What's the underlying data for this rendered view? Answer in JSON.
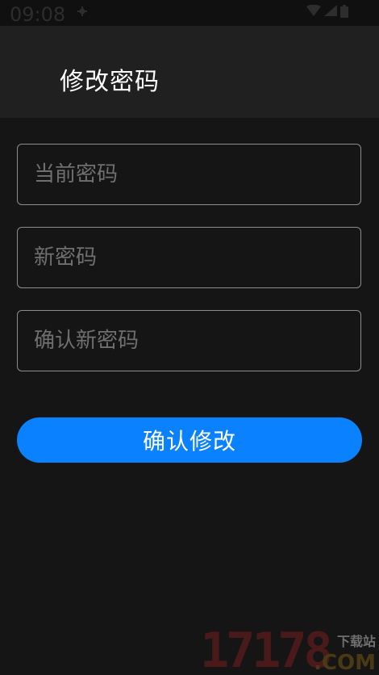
{
  "status_bar": {
    "time": "09:08",
    "icons": [
      "gear-icon",
      "wifi-icon",
      "signal-icon",
      "battery-icon"
    ]
  },
  "app_bar": {
    "title": "修改密码"
  },
  "form": {
    "current_password": {
      "placeholder": "当前密码",
      "value": ""
    },
    "new_password": {
      "placeholder": "新密码",
      "value": ""
    },
    "confirm_password": {
      "placeholder": "确认新密码",
      "value": ""
    },
    "submit_label": "确认修改"
  },
  "watermark": {
    "number": "17178",
    "subtitle": "下载站",
    "domain": ".COM"
  },
  "colors": {
    "background": "#151515",
    "app_bar": "#202020",
    "accent": "#0a82ff",
    "field_border": "#8c8c8c",
    "placeholder": "#6f6f6f"
  }
}
